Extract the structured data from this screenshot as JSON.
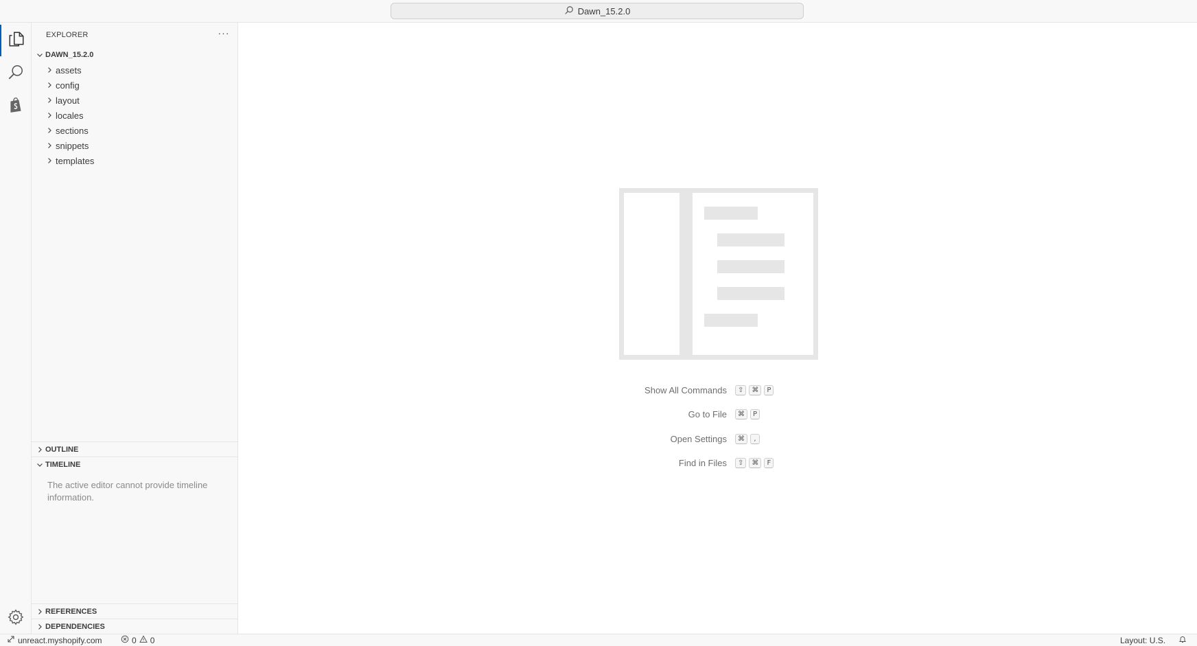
{
  "titlebar": {
    "search_label": "Dawn_15.2.0",
    "search_icon": "search-icon"
  },
  "activitybar": {
    "items": [
      {
        "name": "explorer",
        "icon": "files-icon"
      },
      {
        "name": "search",
        "icon": "search-icon"
      },
      {
        "name": "shopify",
        "icon": "shopify-bag-icon"
      }
    ],
    "settings_icon": "gear-icon"
  },
  "sidebar": {
    "title": "EXPLORER",
    "more_actions": "···",
    "root": "DAWN_15.2.0",
    "folders": [
      "assets",
      "config",
      "layout",
      "locales",
      "sections",
      "snippets",
      "templates"
    ],
    "panels": {
      "outline": "OUTLINE",
      "timeline": "TIMELINE",
      "timeline_message": "The active editor cannot provide timeline information.",
      "references": "REFERENCES",
      "dependencies": "DEPENDENCIES"
    }
  },
  "editor": {
    "shortcuts": [
      {
        "label": "Show All Commands",
        "keys": [
          "⇧",
          "⌘",
          "P"
        ]
      },
      {
        "label": "Go to File",
        "keys": [
          "⌘",
          "P"
        ]
      },
      {
        "label": "Open Settings",
        "keys": [
          "⌘",
          ","
        ]
      },
      {
        "label": "Find in Files",
        "keys": [
          "⇧",
          "⌘",
          "F"
        ]
      }
    ]
  },
  "statusbar": {
    "remote": "unreact.myshopify.com",
    "errors": "0",
    "warnings": "0",
    "layout": "Layout: U.S."
  }
}
